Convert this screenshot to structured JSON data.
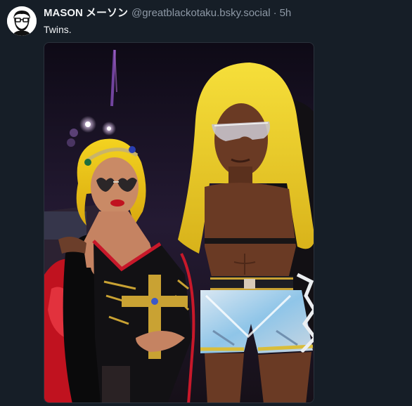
{
  "post": {
    "author": {
      "display_name": "MASON メーソン",
      "handle": "@greatblackotaku.bsky.social",
      "avatar_icon": "avatar-illustration-icon"
    },
    "separator": "·",
    "timestamp": "5h",
    "text": "Twins.",
    "image": {
      "alt": "Two wrestlers in matching blonde wigs and sunglasses posing together"
    }
  },
  "colors": {
    "background": "#161e27",
    "text_primary": "#f1f3f5",
    "text_secondary": "#8d98a5"
  }
}
